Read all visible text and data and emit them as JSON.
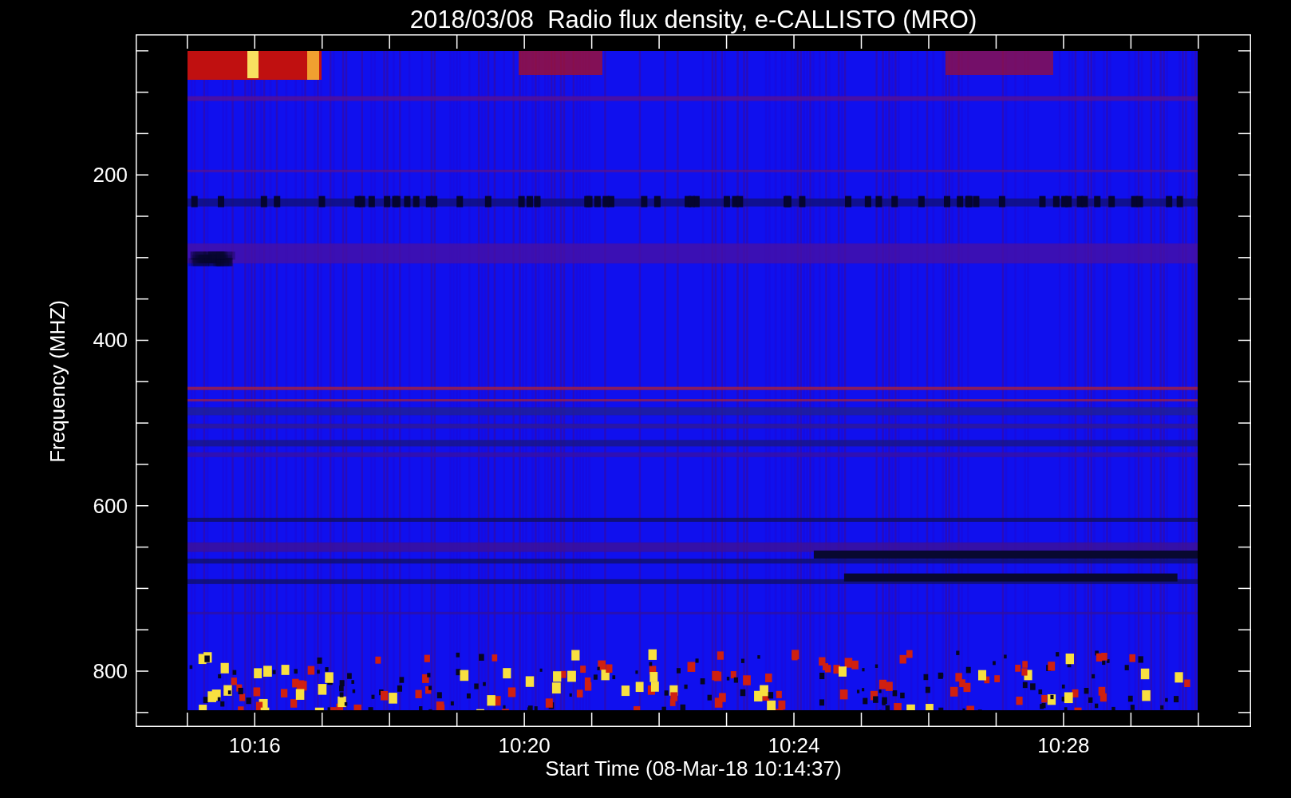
{
  "title": "2018/03/08  Radio flux density, e-CALLISTO (MRO)",
  "y_axis": {
    "label": "Frequency (MHZ)",
    "ticks": [
      "200",
      "400",
      "600",
      "800"
    ]
  },
  "x_axis": {
    "label": "Start Time (08-Mar-18 10:14:37)",
    "ticks": [
      "10:16",
      "10:20",
      "10:24",
      "10:28"
    ]
  }
}
